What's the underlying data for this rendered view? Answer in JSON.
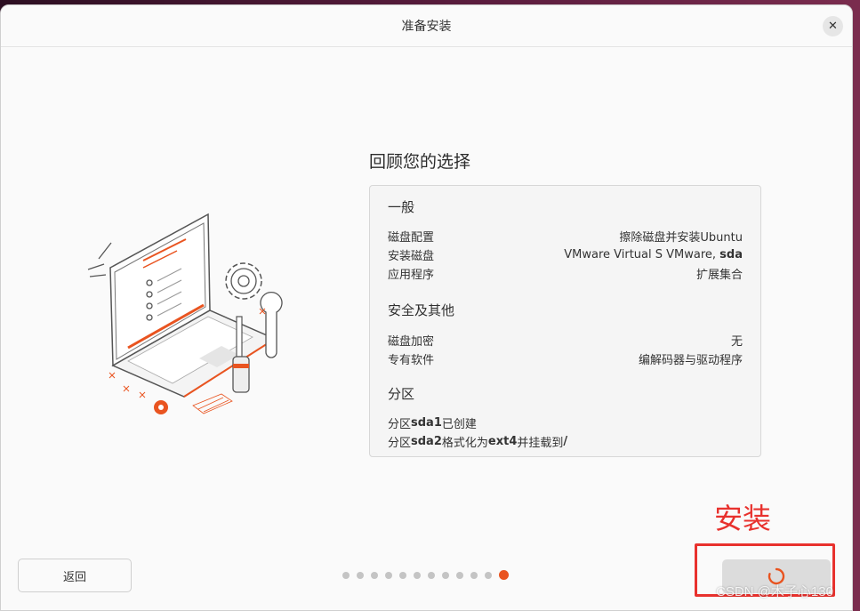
{
  "window": {
    "title": "准备安装"
  },
  "review": {
    "heading": "回顾您的选择"
  },
  "general": {
    "title": "一般",
    "rows": [
      {
        "label": "磁盘配置",
        "value": "擦除磁盘并安装Ubuntu"
      },
      {
        "label": "安装磁盘",
        "value_plain": "VMware Virtual S VMware, ",
        "value_bold": "sda"
      },
      {
        "label": "应用程序",
        "value": "扩展集合"
      }
    ]
  },
  "security": {
    "title": "安全及其他",
    "rows": [
      {
        "label": "磁盘加密",
        "value": "无"
      },
      {
        "label": "专有软件",
        "value": "编解码器与驱动程序"
      }
    ]
  },
  "partitions": {
    "title": "分区",
    "line1": {
      "prefix": "分区 ",
      "disk": "sda1",
      "suffix": " 已创建"
    },
    "line2": {
      "prefix": "分区",
      "disk": "sda2",
      "mid": " 格式化为",
      "fs": "ext4",
      "mid2": " 并挂载到",
      "mount": "/"
    }
  },
  "nav": {
    "back_label": "返回",
    "page_count": 12,
    "current_page": 12
  },
  "annotation": {
    "text": "安装"
  },
  "watermark": "CSDN @木子心130",
  "colors": {
    "accent": "#e95420",
    "annotation": "#e8312d"
  }
}
